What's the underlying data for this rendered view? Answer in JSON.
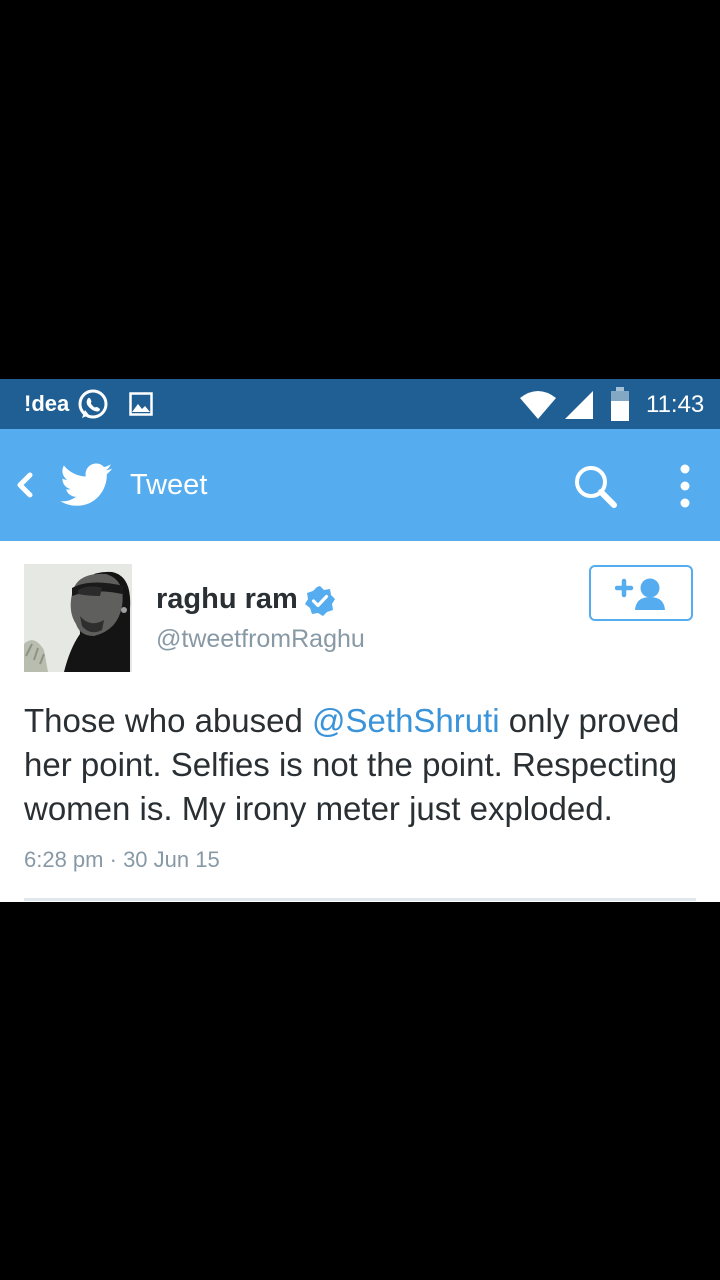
{
  "status_bar": {
    "carrier": "!dea",
    "time": "11:43"
  },
  "app_bar": {
    "title": "Tweet"
  },
  "tweet": {
    "author_name": "raghu ram",
    "author_handle": "@tweetfromRaghu",
    "text_before": "Those who abused ",
    "mention": "@SethShruti",
    "text_after": " only proved her point. Selfies is not the point. Respecting women is. My irony meter just exploded.",
    "time": "6:28 pm",
    "separator": " · ",
    "date": "30 Jun 15"
  },
  "colors": {
    "status_bar": "#1f5f94",
    "app_bar": "#55acee",
    "link": "#3b94d9",
    "muted": "#8899a6",
    "text": "#292f33"
  },
  "icons": [
    "whatsapp-icon",
    "image-icon",
    "wifi-icon",
    "signal-icon",
    "battery-icon",
    "back-icon",
    "twitter-bird-icon",
    "search-icon",
    "more-vert-icon",
    "verified-icon",
    "follow-icon"
  ]
}
